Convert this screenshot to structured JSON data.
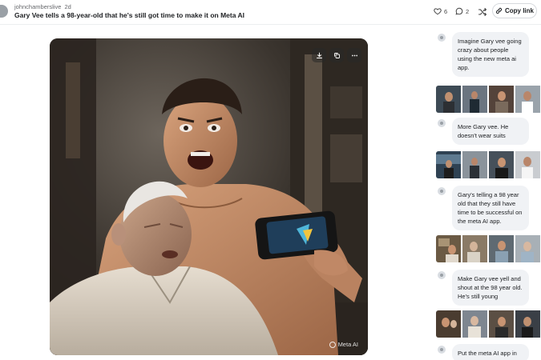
{
  "post": {
    "author": "johnchamberslive",
    "time": "2d",
    "title": "Gary Vee tells a 98-year-old that he's still got time to make it on Meta AI"
  },
  "actions": {
    "likes": "6",
    "comments": "2",
    "copy_link_label": "Copy link"
  },
  "image": {
    "watermark": "Meta AI",
    "actions": [
      "download-icon",
      "copy-icon",
      "more-icon"
    ]
  },
  "thread": [
    {
      "type": "prompt",
      "text": "Imagine Gary vee going crazy about people using the new meta ai app."
    },
    {
      "type": "thumbnails",
      "colors": [
        "#3d4a55",
        "#6b7580",
        "#54433a",
        "#9aa3ab"
      ]
    },
    {
      "type": "prompt",
      "text": "More Gary vee. He doesn't wear suits"
    },
    {
      "type": "thumbnails",
      "colors": [
        "#2f4253",
        "#8a939b",
        "#46505a",
        "#c9ccd0"
      ]
    },
    {
      "type": "prompt",
      "text": "Gary's telling a 98 year old that they still have time to be successful on the meta AI app."
    },
    {
      "type": "thumbnails",
      "colors": [
        "#6b5a44",
        "#8a7a66",
        "#5f6a72",
        "#a8b0b6"
      ]
    },
    {
      "type": "prompt",
      "text": "Make Gary vee yell and shout at the 98 year old. He's still young"
    },
    {
      "type": "thumbnails",
      "colors": [
        "#4a3c30",
        "#7e8690",
        "#5b4f44",
        "#3a3f46"
      ]
    },
    {
      "type": "prompt",
      "text": "Put the meta AI app in"
    }
  ],
  "colors": {
    "bubble": "#f0f2f5",
    "text": "#1c1e21",
    "muted": "#65676b"
  }
}
